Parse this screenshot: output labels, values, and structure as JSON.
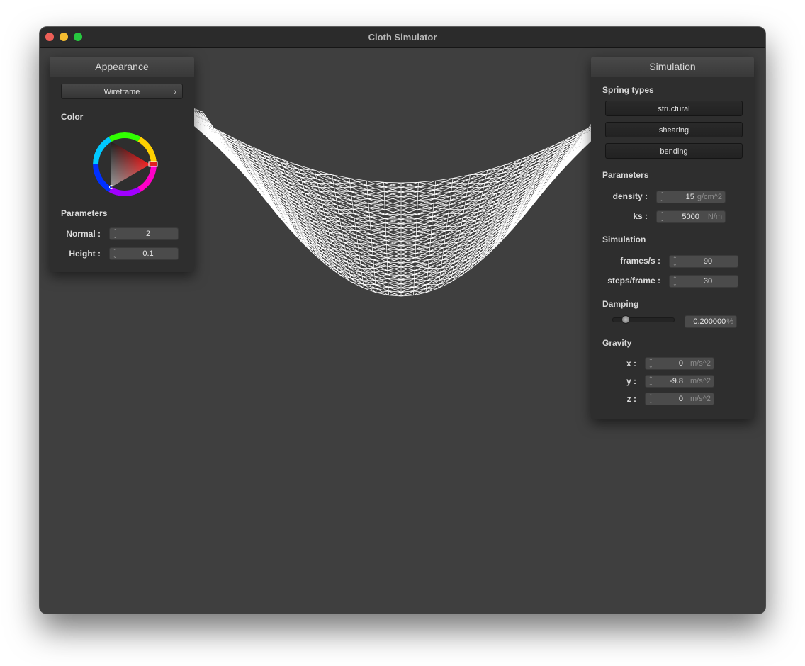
{
  "window": {
    "title": "Cloth Simulator"
  },
  "appearance": {
    "title": "Appearance",
    "shader_dropdown": {
      "value": "Wireframe",
      "chevron": "›"
    },
    "color_label": "Color",
    "color_wheel": {
      "icon": "color-wheel-icon",
      "selected_color": "#ff0000"
    },
    "parameters_label": "Parameters",
    "normal": {
      "label": "Normal :",
      "value": "2"
    },
    "height": {
      "label": "Height :",
      "value": "0.1"
    }
  },
  "simulation": {
    "title": "Simulation",
    "spring_types_label": "Spring types",
    "springs": [
      {
        "label": "structural"
      },
      {
        "label": "shearing"
      },
      {
        "label": "bending"
      }
    ],
    "parameters_label": "Parameters",
    "density": {
      "label": "density :",
      "value": "15",
      "unit": "g/cm^2"
    },
    "ks": {
      "label": "ks :",
      "value": "5000",
      "unit": "N/m"
    },
    "simulation_label": "Simulation",
    "frames": {
      "label": "frames/s :",
      "value": "90"
    },
    "steps": {
      "label": "steps/frame :",
      "value": "30"
    },
    "damping_label": "Damping",
    "damping": {
      "value": "0.200000",
      "unit": "%",
      "slider_fraction": 0.2
    },
    "gravity_label": "Gravity",
    "gravity": [
      {
        "label": "x :",
        "value": "0",
        "unit": "m/s^2"
      },
      {
        "label": "y :",
        "value": "-9.8",
        "unit": "m/s^2"
      },
      {
        "label": "z :",
        "value": "0",
        "unit": "m/s^2"
      }
    ]
  },
  "colors": {
    "background": "#3f3f3f",
    "panel": "#2e2e2e",
    "cloth": "#ffffff"
  }
}
